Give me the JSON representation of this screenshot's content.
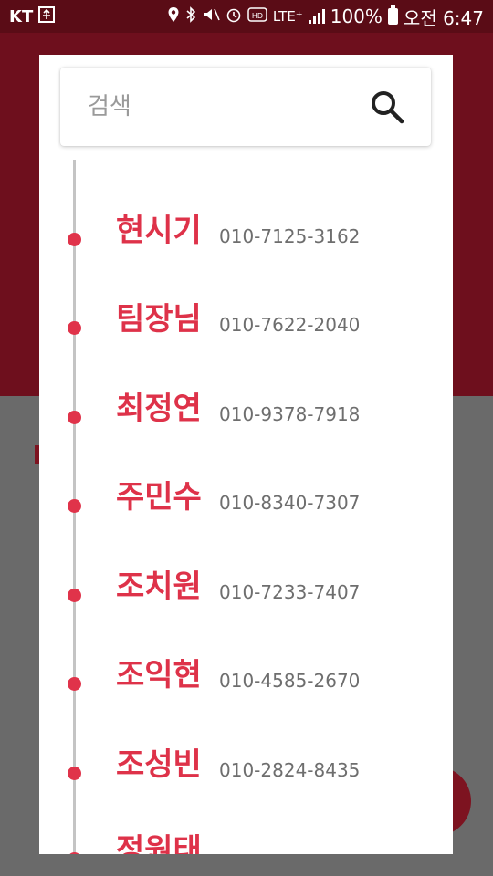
{
  "status_bar": {
    "carrier": "KT",
    "battery": "100%",
    "time": "오전 6:47",
    "lte": "LTE⁺",
    "icons": [
      "usb-icon",
      "location-icon",
      "bluetooth-icon",
      "mute-icon",
      "alarm-icon",
      "hd-icon",
      "signal-icon",
      "battery-icon"
    ]
  },
  "search": {
    "placeholder": "검색",
    "icon": "search-icon"
  },
  "contacts": [
    {
      "name": "현시기",
      "phone": "010-7125-3162"
    },
    {
      "name": "팀장님",
      "phone": "010-7622-2040"
    },
    {
      "name": "최정연",
      "phone": "010-9378-7918"
    },
    {
      "name": "주민수",
      "phone": "010-8340-7307"
    },
    {
      "name": "조치원",
      "phone": "010-7233-7407"
    },
    {
      "name": "조익현",
      "phone": "010-4585-2670"
    },
    {
      "name": "조성빈",
      "phone": "010-2824-8435"
    },
    {
      "name": "정원태",
      "phone": ""
    }
  ],
  "colors": {
    "accent": "#de3249",
    "header": "#6e0f1d",
    "statusbar": "#5a0c16",
    "overlay": "#6a6a6a"
  }
}
